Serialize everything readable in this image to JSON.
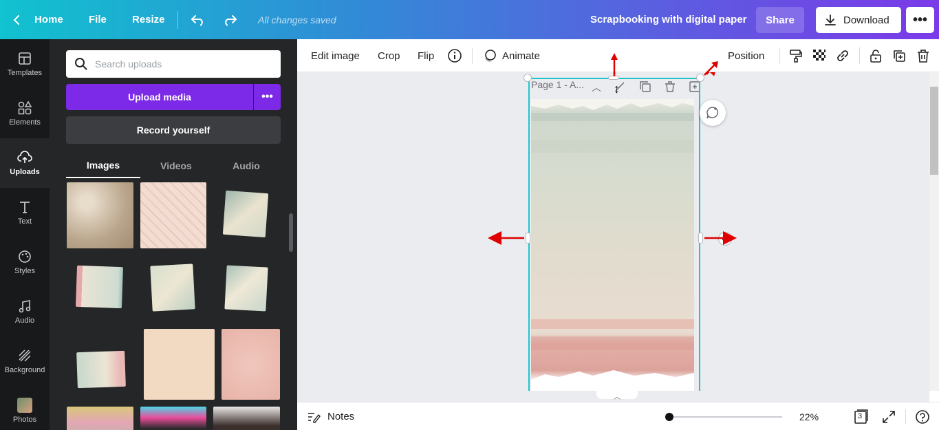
{
  "topbar": {
    "home": "Home",
    "file": "File",
    "resize": "Resize",
    "saved_status": "All changes saved",
    "title": "Scrapbooking with digital paper",
    "share": "Share",
    "download": "Download"
  },
  "leftnav": {
    "items": [
      {
        "label": "Templates",
        "icon": "templates-icon"
      },
      {
        "label": "Elements",
        "icon": "elements-icon"
      },
      {
        "label": "Uploads",
        "icon": "uploads-icon"
      },
      {
        "label": "Text",
        "icon": "text-icon"
      },
      {
        "label": "Styles",
        "icon": "styles-icon"
      },
      {
        "label": "Audio",
        "icon": "audio-icon"
      },
      {
        "label": "Background",
        "icon": "background-icon"
      },
      {
        "label": "Photos",
        "icon": "photos-icon"
      }
    ],
    "active": "Uploads"
  },
  "panel": {
    "search_placeholder": "Search uploads",
    "upload_media": "Upload media",
    "record_yourself": "Record yourself",
    "tabs": [
      "Images",
      "Videos",
      "Audio"
    ],
    "active_tab": "Images"
  },
  "toolbar": {
    "edit_image": "Edit image",
    "crop": "Crop",
    "flip": "Flip",
    "animate": "Animate",
    "position": "Position"
  },
  "canvas": {
    "page_label": "Page 1 - A..."
  },
  "bottombar": {
    "notes": "Notes",
    "zoom": "22%",
    "page_count": "3",
    "zoom_level": 0.22
  },
  "colors": {
    "accent_purple": "#7d2ae8",
    "selection_teal": "#20c4cb",
    "arrow_red": "#e00000",
    "panel_dark": "#252627",
    "nav_dark": "#18191b"
  }
}
